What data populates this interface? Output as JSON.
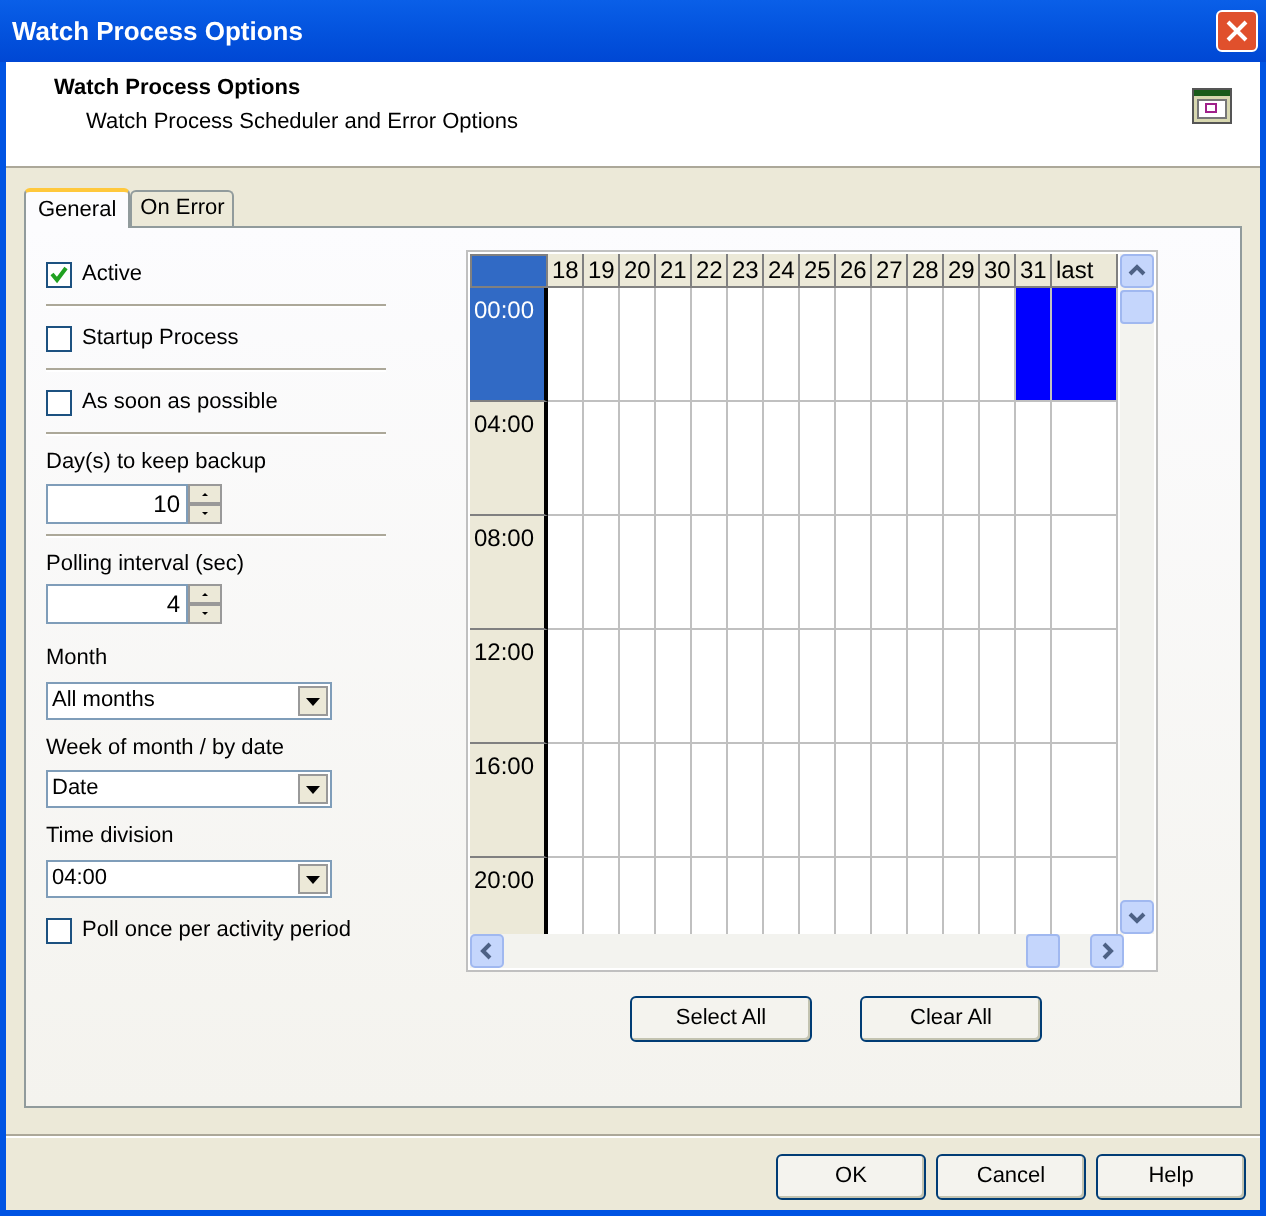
{
  "window": {
    "title": "Watch Process Options"
  },
  "header": {
    "title": "Watch Process Options",
    "subtitle": "Watch Process Scheduler and Error Options"
  },
  "tabs": [
    {
      "label": "General",
      "selected": true
    },
    {
      "label": "On Error",
      "selected": false
    }
  ],
  "options": [
    {
      "kind": "checkbox",
      "label": "Active",
      "checked": true
    },
    {
      "kind": "checkbox",
      "label": "Startup Process",
      "checked": false
    },
    {
      "kind": "checkbox",
      "label": "As soon as possible",
      "checked": false
    },
    {
      "kind": "spinner",
      "label": "Day(s) to keep backup",
      "value": "10"
    },
    {
      "kind": "spinner",
      "label": "Polling interval (sec)",
      "value": "4"
    },
    {
      "kind": "dropdown",
      "label": "Month",
      "value": "All months"
    },
    {
      "kind": "dropdown",
      "label": "Week of month / by date",
      "value": "Date"
    },
    {
      "kind": "dropdown",
      "label": "Time division",
      "value": "04:00"
    },
    {
      "kind": "checkbox",
      "label": "Poll once per activity period",
      "checked": false
    }
  ],
  "grid": {
    "columns": [
      "18",
      "19",
      "20",
      "21",
      "22",
      "23",
      "24",
      "25",
      "26",
      "27",
      "28",
      "29",
      "30",
      "31",
      "last"
    ],
    "rows": [
      {
        "label": "00:00",
        "selected": true,
        "cells": [
          false,
          false,
          false,
          false,
          false,
          false,
          false,
          false,
          false,
          false,
          false,
          false,
          false,
          true,
          true
        ]
      },
      {
        "label": "04:00",
        "selected": false,
        "cells": [
          false,
          false,
          false,
          false,
          false,
          false,
          false,
          false,
          false,
          false,
          false,
          false,
          false,
          false,
          false
        ]
      },
      {
        "label": "08:00",
        "selected": false,
        "cells": [
          false,
          false,
          false,
          false,
          false,
          false,
          false,
          false,
          false,
          false,
          false,
          false,
          false,
          false,
          false
        ]
      },
      {
        "label": "12:00",
        "selected": false,
        "cells": [
          false,
          false,
          false,
          false,
          false,
          false,
          false,
          false,
          false,
          false,
          false,
          false,
          false,
          false,
          false
        ]
      },
      {
        "label": "16:00",
        "selected": false,
        "cells": [
          false,
          false,
          false,
          false,
          false,
          false,
          false,
          false,
          false,
          false,
          false,
          false,
          false,
          false,
          false
        ]
      },
      {
        "label": "20:00",
        "selected": false,
        "cells": [
          false,
          false,
          false,
          false,
          false,
          false,
          false,
          false,
          false,
          false,
          false,
          false,
          false,
          false,
          false
        ]
      }
    ]
  },
  "grid_buttons": [
    "Select All",
    "Clear All"
  ],
  "buttons": [
    "OK",
    "Cancel",
    "Help"
  ]
}
